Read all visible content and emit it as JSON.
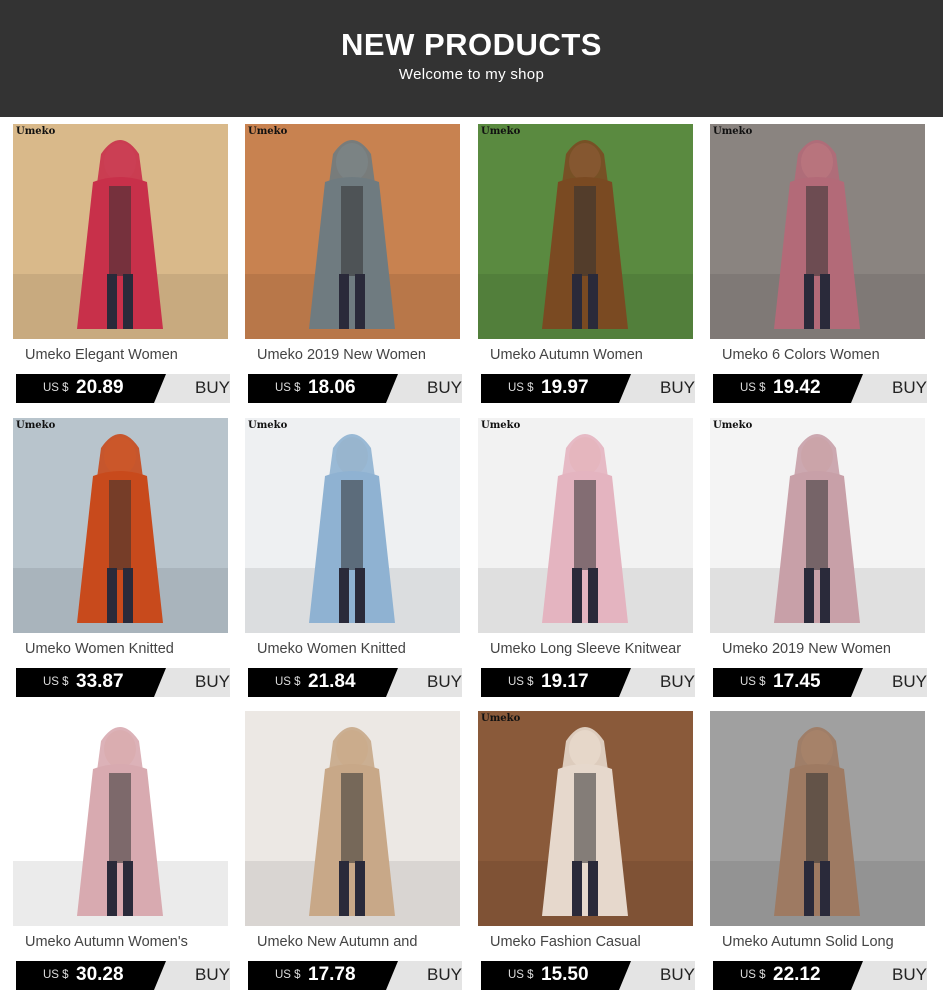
{
  "header": {
    "title": "NEW PRODUCTS",
    "subtitle": "Welcome to my shop"
  },
  "products": [
    {
      "brand": "Umeko",
      "title": "Umeko Elegant Women",
      "currency": "US $",
      "price": "20.89",
      "buy_label": "BUY",
      "color": "#c8304a",
      "bg": "#d9b98a"
    },
    {
      "brand": "Umeko",
      "title": "Umeko 2019 New Women",
      "currency": "US $",
      "price": "18.06",
      "buy_label": "BUY",
      "color": "#6f7b80",
      "bg": "#c88250"
    },
    {
      "brand": "Umeko",
      "title": "Umeko Autumn Women",
      "currency": "US $",
      "price": "19.97",
      "buy_label": "BUY",
      "color": "#7a4a22",
      "bg": "#5a8a40"
    },
    {
      "brand": "Umeko",
      "title": "Umeko 6 Colors Women",
      "currency": "US $",
      "price": "19.42",
      "buy_label": "BUY",
      "color": "#b36a78",
      "bg": "#8a8480"
    },
    {
      "brand": "Umeko",
      "title": "Umeko Women Knitted",
      "currency": "US $",
      "price": "33.87",
      "buy_label": "BUY",
      "color": "#c84a1c",
      "bg": "#b8c4cc"
    },
    {
      "brand": "Umeko",
      "title": "Umeko Women Knitted",
      "currency": "US $",
      "price": "21.84",
      "buy_label": "BUY",
      "color": "#8fb2d2",
      "bg": "#eef0f2"
    },
    {
      "brand": "Umeko",
      "title": "Umeko Long Sleeve Knitwear",
      "currency": "US $",
      "price": "19.17",
      "buy_label": "BUY",
      "color": "#e4b4c0",
      "bg": "#f2f2f2"
    },
    {
      "brand": "Umeko",
      "title": "Umeko 2019 New Women",
      "currency": "US $",
      "price": "17.45",
      "buy_label": "BUY",
      "color": "#c8a0a8",
      "bg": "#f4f4f4"
    },
    {
      "brand": "",
      "title": "Umeko Autumn Women's",
      "currency": "US $",
      "price": "30.28",
      "buy_label": "BUY",
      "color": "#d8aab0",
      "bg": "#ffffff"
    },
    {
      "brand": "",
      "title": "Umeko New Autumn and",
      "currency": "US $",
      "price": "17.78",
      "buy_label": "BUY",
      "color": "#c8a888",
      "bg": "#ece8e4"
    },
    {
      "brand": "Umeko",
      "title": "Umeko Fashion Casual",
      "currency": "US $",
      "price": "15.50",
      "buy_label": "BUY",
      "color": "#e6d8cc",
      "bg": "#8a5a3a"
    },
    {
      "brand": "",
      "title": "Umeko Autumn Solid Long",
      "currency": "US $",
      "price": "22.12",
      "buy_label": "BUY",
      "color": "#9e7a62",
      "bg": "#a0a0a0"
    }
  ]
}
